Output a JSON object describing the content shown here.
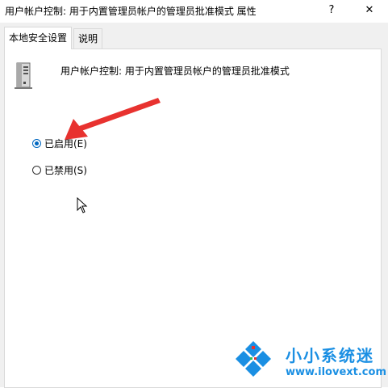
{
  "window": {
    "title": "用户帐户控制: 用于内置管理员帐户的管理员批准模式 属性",
    "help_glyph": "?",
    "close_glyph": "✕"
  },
  "tabs": [
    {
      "label": "本地安全设置",
      "active": true
    },
    {
      "label": "说明",
      "active": false
    }
  ],
  "policy": {
    "icon": "server-policy-icon",
    "name": "用户帐户控制: 用于内置管理员帐户的管理员批准模式"
  },
  "options": [
    {
      "label": "已启用(E)",
      "selected": true
    },
    {
      "label": "已禁用(S)",
      "selected": false
    }
  ],
  "watermark": {
    "name": "小小系统迷",
    "url": "www.ilovext.com"
  },
  "colors": {
    "accent": "#0067c0",
    "annotation_arrow": "#e8322f",
    "watermark": "#1a8fe3"
  }
}
